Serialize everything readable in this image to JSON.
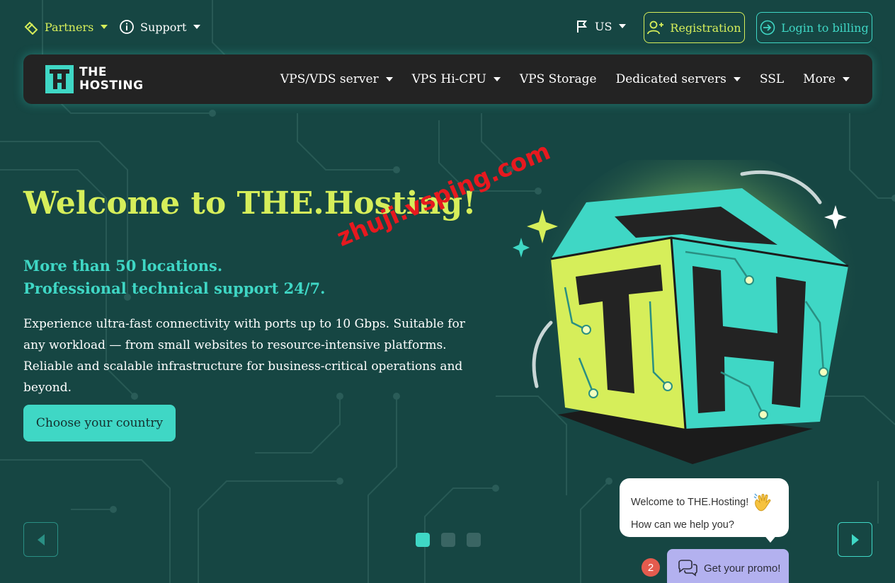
{
  "topbar": {
    "partners_label": "Partners",
    "support_label": "Support",
    "language_label": "US",
    "registration_label": "Registration",
    "login_label": "Login to billing"
  },
  "logo": {
    "line1": "THE",
    "line2": "HOSTING"
  },
  "nav": {
    "items": [
      {
        "label": "VPS/VDS server",
        "dropdown": true
      },
      {
        "label": "VPS Hi-CPU",
        "dropdown": true
      },
      {
        "label": "VPS Storage",
        "dropdown": false
      },
      {
        "label": "Dedicated servers",
        "dropdown": true
      },
      {
        "label": "SSL",
        "dropdown": false
      },
      {
        "label": "More",
        "dropdown": true
      }
    ]
  },
  "hero": {
    "title": "Welcome to THE.Hosting!",
    "subtitle_line1": "More than 50 locations.",
    "subtitle_line2": "Professional technical support 24/7.",
    "description": "Experience ultra-fast connectivity with ports up to 10 Gbps. Suitable for any workload — from small websites to resource-intensive platforms. Reliable and scalable infrastructure for business-critical operations and beyond.",
    "cta_label": "Choose your country"
  },
  "watermark": "zhuji.vsping.com",
  "slider": {
    "slide_count": 3,
    "active_index": 0
  },
  "chat": {
    "greeting": "Welcome to THE.Hosting!",
    "prompt": "How can we help you?",
    "promo_label": "Get your promo!",
    "badge_count": "2"
  },
  "colors": {
    "background": "#164643",
    "accent_yellow": "#d6ee5a",
    "accent_teal": "#3fd7c5",
    "nav_bg": "#232323",
    "promo_bg": "#b3b1ef",
    "badge_red": "#e45b4e"
  }
}
